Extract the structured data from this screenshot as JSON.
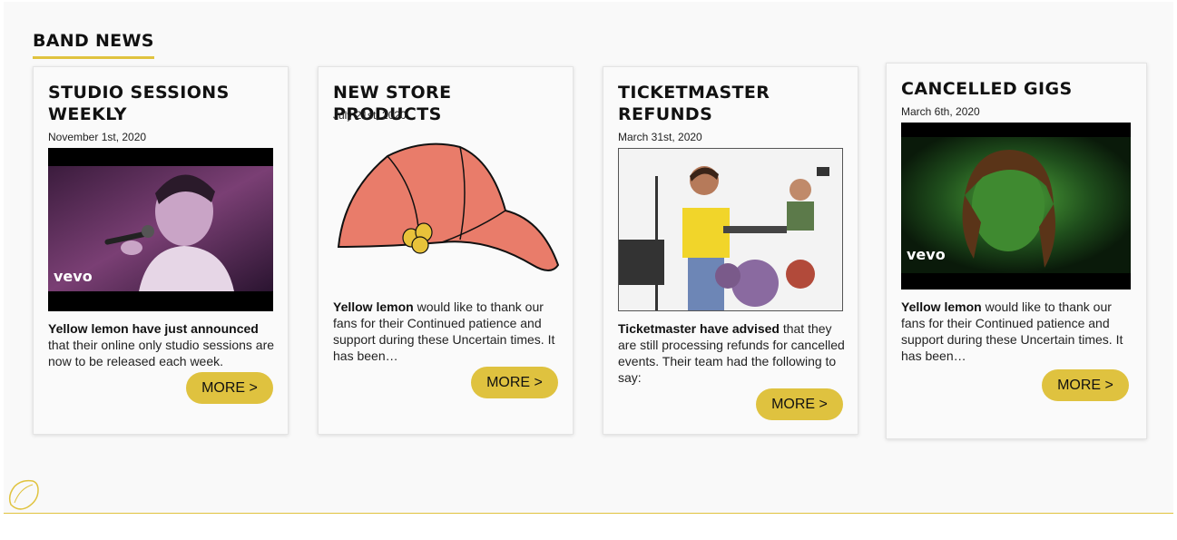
{
  "section": {
    "title": "BAND NEWS"
  },
  "cards": [
    {
      "title": "STUDIO SESSIONS WEEKLY",
      "date": "November 1st, 2020",
      "media_badge": "vevo",
      "excerpt_bold": "Yellow lemon have just announced",
      "excerpt_rest": " that their online only studio sessions are now to be released each week.",
      "button_label": "MORE >"
    },
    {
      "title": "NEW STORE PRODUCTS",
      "date": "July 21st, 2020",
      "excerpt_bold": "Yellow lemon",
      "excerpt_rest": " would like to thank our fans for their Continued patience and support during these Uncertain times. It has been…",
      "button_label": "MORE >"
    },
    {
      "title": "TICKETMASTER REFUNDS",
      "date": "March 31st, 2020",
      "excerpt_bold": "Ticketmaster have advised",
      "excerpt_rest": " that they are still processing refunds for cancelled events. Their team had the following to say:",
      "button_label": "MORE >"
    },
    {
      "title": "CANCELLED GIGS",
      "date": "March 6th, 2020",
      "media_badge": "vevo",
      "excerpt_bold": "Yellow lemon",
      "excerpt_rest": " would like to thank our fans for their Continued patience and support during these Uncertain times. It has been…",
      "button_label": "MORE >"
    }
  ],
  "colors": {
    "accent": "#dfc23f",
    "cap": "#e97c6a",
    "background": "#f9f9f9"
  },
  "icons": {
    "footer": "lemon-outline-icon"
  }
}
